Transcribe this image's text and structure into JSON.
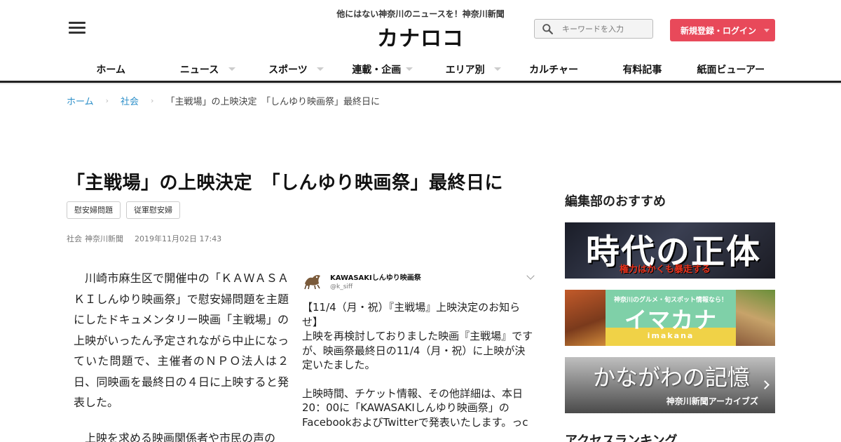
{
  "header": {
    "tagline": "他にはない神奈川のニュースを！神奈川新聞",
    "logo": "カナロコ",
    "search_placeholder": "キーワードを入力",
    "login_label": "新規登録・ログイン",
    "accent_color": "#e8495a"
  },
  "nav": {
    "items": [
      {
        "label": "ホーム",
        "dropdown": false
      },
      {
        "label": "ニュース",
        "dropdown": true
      },
      {
        "label": "スポーツ",
        "dropdown": true
      },
      {
        "label": "連載・企画",
        "dropdown": true
      },
      {
        "label": "エリア別",
        "dropdown": true
      },
      {
        "label": "カルチャー",
        "dropdown": false
      },
      {
        "label": "有料記事",
        "dropdown": false
      },
      {
        "label": "紙面ビューアー",
        "dropdown": false
      }
    ]
  },
  "breadcrumb": {
    "home": "ホーム",
    "category": "社会",
    "current": "「主戦場」の上映決定　「しんゆり映画祭」最終日に",
    "link_color": "#2c8fc9"
  },
  "article": {
    "title": "「主戦場」の上映決定　「しんゆり映画祭」最終日に",
    "tags": [
      "慰安婦問題",
      "従軍慰安婦"
    ],
    "category": "社会",
    "source": "神奈川新聞",
    "date": "2019年11月02日 17:43",
    "paragraphs": [
      "川崎市麻生区で開催中の「ＫＡＷＡＳＡＫＩしんゆり映画祭」で慰安婦問題を主題にしたドキュメンタリー映画「主戦場」の上映がいったん予定されながら中止になっていた問題で、主催者のＮＰＯ法人は２日、同映画を最終日の４日に上映すると発表した。",
      "上映を求める映画関係者や市民の声の"
    ]
  },
  "tweet": {
    "name": "KAWASAKIしんゆり映画祭",
    "handle": "@k_siff",
    "paragraphs": [
      "【11/4（月・祝）『主戦場』上映決定のお知らせ】\n上映を再検討しておりました映画『主戦場』ですが、映画祭最終日の11/4（月・祝）に上映が決定いたました。",
      "上映時間、チケット情報、その他詳細は、本日20：00に「KAWASAKIしんゆり映画祭」のFacebookおよびTwitterで発表いたします。っc"
    ]
  },
  "sidebar": {
    "recommend_title": "編集部のおすすめ",
    "banners": [
      {
        "title": "時代の正体",
        "subtitle": "権力はかくも暴走する"
      },
      {
        "top_text": "神奈川のグルメ・旬スポット情報なら！",
        "title": "イマカナ",
        "roman": "imakana"
      },
      {
        "title": "かながわの記憶",
        "subtitle": "神奈川新聞アーカイブズ"
      }
    ],
    "ranking_title": "アクセスランキング"
  }
}
